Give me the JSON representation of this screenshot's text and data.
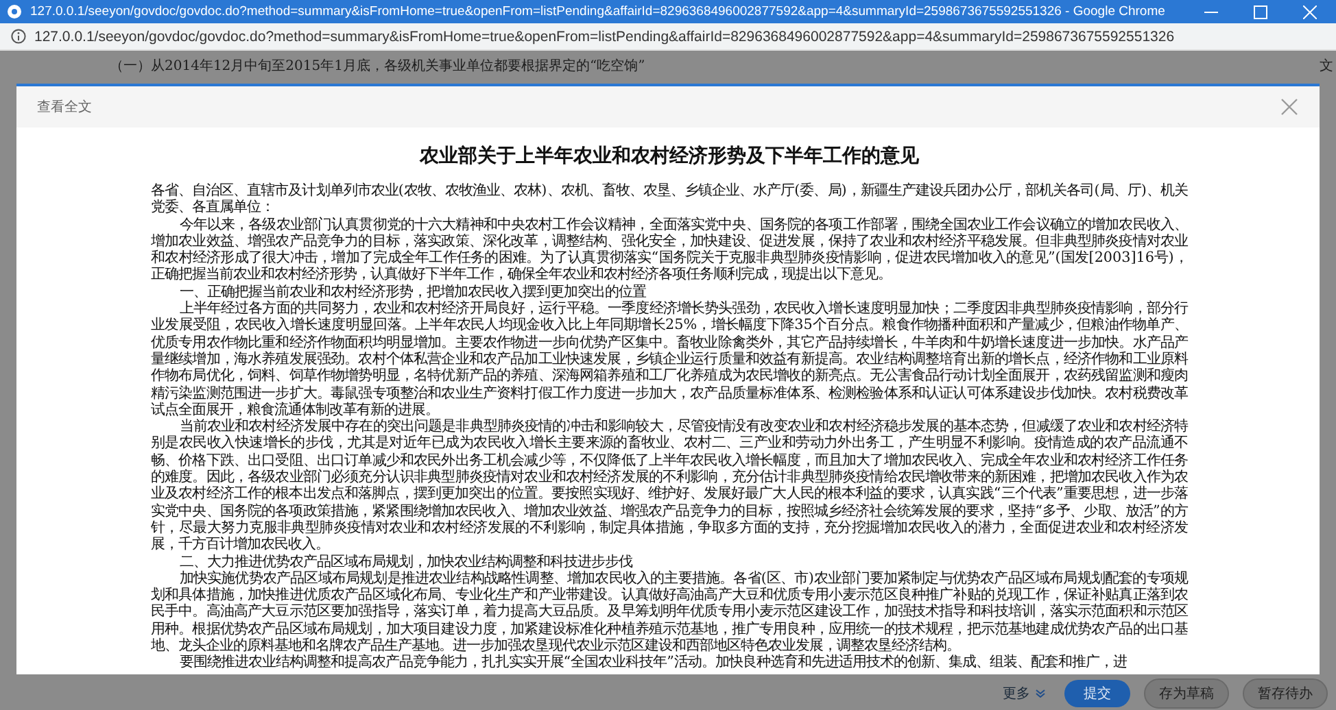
{
  "browser": {
    "title": "127.0.0.1/seeyon/govdoc/govdoc.do?method=summary&isFromHome=true&openFrom=listPending&affairId=8296368496002877592&app=4&summaryId=2598673675592551326 - Google Chrome",
    "url": "127.0.0.1/seeyon/govdoc/govdoc.do?method=summary&isFromHome=true&openFrom=listPending&affairId=8296368496002877592&app=4&summaryId=2598673675592551326"
  },
  "background_page": {
    "notice": "（一）从2014年12月中旬至2015年1月底，各级机关事业单位都要根据界定的“吃空饷”",
    "side_label": "文",
    "actions": [
      {
        "label": "更多",
        "kind": "menu"
      },
      {
        "label": "提交",
        "kind": "primary"
      },
      {
        "label": "存为草稿",
        "kind": "plain"
      },
      {
        "label": "暂存待办",
        "kind": "plain"
      }
    ]
  },
  "dialog": {
    "title": "查看全文",
    "document": {
      "title": "农业部关于上半年农业和农村经济形势及下半年工作的意见",
      "paragraphs": [
        {
          "kind": "salutation",
          "text": "各省、自治区、直辖市及计划单列市农业(农牧、农牧渔业、农林)、农机、畜牧、农垦、乡镇企业、水产厅(委、局)，新疆生产建设兵团办公厅，部机关各司(局、厅)、机关党委、各直属单位："
        },
        {
          "kind": "body",
          "text": "今年以来，各级农业部门认真贯彻党的十六大精神和中央农村工作会议精神，全面落实党中央、国务院的各项工作部署，围绕全国农业工作会议确立的增加农民收入、增加农业效益、增强农产品竞争力的目标，落实政策、深化改革，调整结构、强化安全，加快建设、促进发展，保持了农业和农村经济平稳发展。但非典型肺炎疫情对农业和农村经济形成了很大冲击，增加了完成全年工作任务的困难。为了认真贯彻落实“国务院关于克服非典型肺炎疫情影响，促进农民增加收入的意见”(国发[2003]16号)，正确把握当前农业和农村经济形势，认真做好下半年工作，确保全年农业和农村经济各项任务顺利完成，现提出以下意见。"
        },
        {
          "kind": "body",
          "text": "一、正确把握当前农业和农村经济形势，把增加农民收入摆到更加突出的位置"
        },
        {
          "kind": "body",
          "text": "上半年经过各方面的共同努力，农业和农村经济开局良好，运行平稳。一季度经济增长势头强劲，农民收入增长速度明显加快；二季度因非典型肺炎疫情影响，部分行业发展受阻，农民收入增长速度明显回落。上半年农民人均现金收入比上年同期增长25%，增长幅度下降35个百分点。粮食作物播种面积和产量减少，但粮油作物单产、优质专用农作物比重和经济作物面积均明显增加。主要农作物进一步向优势产区集中。畜牧业除禽类外，其它产品持续增长，牛羊肉和牛奶增长速度进一步加快。水产品产量继续增加，海水养殖发展强劲。农村个体私营企业和农产品加工业快速发展，乡镇企业运行质量和效益有新提高。农业结构调整培育出新的增长点，经济作物和工业原料作物布局优化，饲料、饲草作物增势明显，名特优新产品的养殖、深海网箱养殖和工厂化养殖成为农民增收的新亮点。无公害食品行动计划全面展开，农药残留监测和瘦肉精污染监测范围进一步扩大。毒鼠强专项整治和农业生产资料打假工作力度进一步加大，农产品质量标准体系、检测检验体系和认证认可体系建设步伐加快。农村税费改革试点全面展开，粮食流通体制改革有新的进展。"
        },
        {
          "kind": "body",
          "text": "当前农业和农村经济发展中存在的突出问题是非典型肺炎疫情的冲击和影响较大，尽管疫情没有改变农业和农村经济稳步发展的基本态势，但减缓了农业和农村经济特别是农民收入快速增长的步伐，尤其是对近年已成为农民收入增长主要来源的畜牧业、农村二、三产业和劳动力外出务工，产生明显不利影响。疫情造成的农产品流通不畅、价格下跌、出口受阻、出口订单减少和农民外出务工机会减少等，不仅降低了上半年农民收入增长幅度，而且加大了增加农民收入、完成全年农业和农村经济工作任务的难度。因此，各级农业部门必须充分认识非典型肺炎疫情对农业和农村经济发展的不利影响，充分估计非典型肺炎疫情给农民增收带来的新困难，把增加农民收入作为农业及农村经济工作的根本出发点和落脚点，摆到更加突出的位置。要按照实现好、维护好、发展好最广大人民的根本利益的要求，认真实践“三个代表”重要思想，进一步落实党中央、国务院的各项政策措施，紧紧围绕增加农民收入、增加农业效益、增强农产品竞争力的目标，按照城乡经济社会统筹发展的要求，坚持“多予、少取、放活”的方针，尽最大努力克服非典型肺炎疫情对农业和农村经济发展的不利影响，制定具体措施，争取多方面的支持，充分挖掘增加农民收入的潜力，全面促进农业和农村经济发展，千方百计增加农民收入。"
        },
        {
          "kind": "body",
          "text": "二、大力推进优势农产品区域布局规划，加快农业结构调整和科技进步步伐"
        },
        {
          "kind": "body",
          "text": "加快实施优势农产品区域布局规划是推进农业结构战略性调整、增加农民收入的主要措施。各省(区、市)农业部门要加紧制定与优势农产品区域布局规划配套的专项规划和具体措施，加快推进优质农产品区域化布局、专业化生产和产业带建设。认真做好高油高产大豆和优质专用小麦示范区良种推广补贴的兑现工作，保证补贴真正落到农民手中。高油高产大豆示范区要加强指导，落实订单，着力提高大豆品质。及早筹划明年优质专用小麦示范区建设工作，加强技术指导和科技培训，落实示范面积和示范区用种。根据优势农产品区域布局规划，加大项目建设力度，加紧建设标准化种植养殖示范基地，推广专用良种，应用统一的技术规程，把示范基地建成优势农产品的出口基地、龙头企业的原料基地和名牌农产品生产基地。进一步加强农垦现代农业示范区建设和西部地区特色农业发展，调整农垦经济结构。"
        },
        {
          "kind": "body",
          "text": "要围绕推进农业结构调整和提高农产品竞争能力，扎扎实实开展“全国农业科技年”活动。加快良种选育和先进适用技术的创新、集成、组装、配套和推广，进"
        }
      ]
    }
  }
}
